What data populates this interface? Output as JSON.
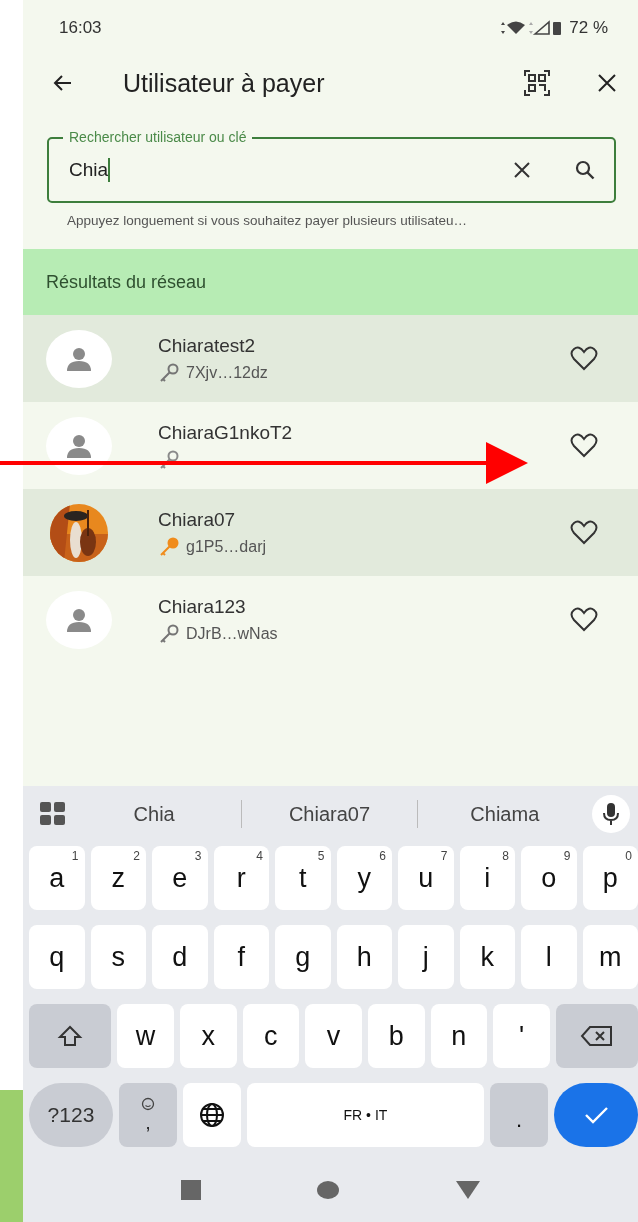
{
  "status_bar": {
    "time": "16:03",
    "battery": "72 %"
  },
  "app_bar": {
    "title": "Utilisateur à payer"
  },
  "search": {
    "label": "Rechercher utilisateur ou clé",
    "value": "Chia",
    "helper": "Appuyez longuement si vous souhaitez payer plusieurs utilisateu…"
  },
  "section": {
    "title": "Résultats du réseau"
  },
  "results": [
    {
      "name": "Chiaratest2",
      "key": "7Xjv…12dz",
      "kind": "placeholder",
      "color": "#757575",
      "favorite": false
    },
    {
      "name": "ChiaraG1nkoT2",
      "kind": "placeholder",
      "favorite": false
    },
    {
      "name": "Chiara07",
      "key": "g1P5…darj",
      "kind": "picture",
      "color": "#f08c1c",
      "favorite": false
    },
    {
      "name": "Chiara123",
      "key": "DJrB…wNas",
      "kind": "placeholder",
      "color": "#757575",
      "favorite": false
    }
  ],
  "keyboard": {
    "suggestions": [
      "Chia",
      "Chiara07",
      "Chiama"
    ],
    "rows": [
      {
        "keys": [
          {
            "kind": "letter",
            "label": "a",
            "hint": "1"
          },
          {
            "kind": "letter",
            "label": "z",
            "hint": "2"
          },
          {
            "kind": "letter",
            "label": "e",
            "hint": "3"
          },
          {
            "kind": "letter",
            "label": "r",
            "hint": "4"
          },
          {
            "kind": "letter",
            "label": "t",
            "hint": "5"
          },
          {
            "kind": "letter",
            "label": "y",
            "hint": "6"
          },
          {
            "kind": "letter",
            "label": "u",
            "hint": "7"
          },
          {
            "kind": "letter",
            "label": "i",
            "hint": "8"
          },
          {
            "kind": "letter",
            "label": "o",
            "hint": "9"
          },
          {
            "kind": "letter",
            "label": "p",
            "hint": "0"
          }
        ]
      },
      {
        "keys": [
          {
            "kind": "letter",
            "label": "q"
          },
          {
            "kind": "letter",
            "label": "s"
          },
          {
            "kind": "letter",
            "label": "d"
          },
          {
            "kind": "letter",
            "label": "f"
          },
          {
            "kind": "letter",
            "label": "g"
          },
          {
            "kind": "letter",
            "label": "h"
          },
          {
            "kind": "letter",
            "label": "j"
          },
          {
            "kind": "letter",
            "label": "k"
          },
          {
            "kind": "letter",
            "label": "l"
          },
          {
            "kind": "letter",
            "label": "m"
          }
        ]
      },
      {
        "keys": [
          {
            "kind": "shift"
          },
          {
            "kind": "letter",
            "label": "w"
          },
          {
            "kind": "letter",
            "label": "x"
          },
          {
            "kind": "letter",
            "label": "c"
          },
          {
            "kind": "letter",
            "label": "v"
          },
          {
            "kind": "letter",
            "label": "b"
          },
          {
            "kind": "letter",
            "label": "n"
          },
          {
            "kind": "letter",
            "label": "'"
          },
          {
            "kind": "backspace"
          }
        ]
      },
      {
        "keys": [
          {
            "kind": "symbols",
            "label": "?123"
          },
          {
            "kind": "emoji",
            "label": ","
          },
          {
            "kind": "globe"
          },
          {
            "kind": "space",
            "label": "FR • IT"
          },
          {
            "kind": "function",
            "label": "."
          },
          {
            "kind": "enter"
          }
        ]
      }
    ]
  }
}
